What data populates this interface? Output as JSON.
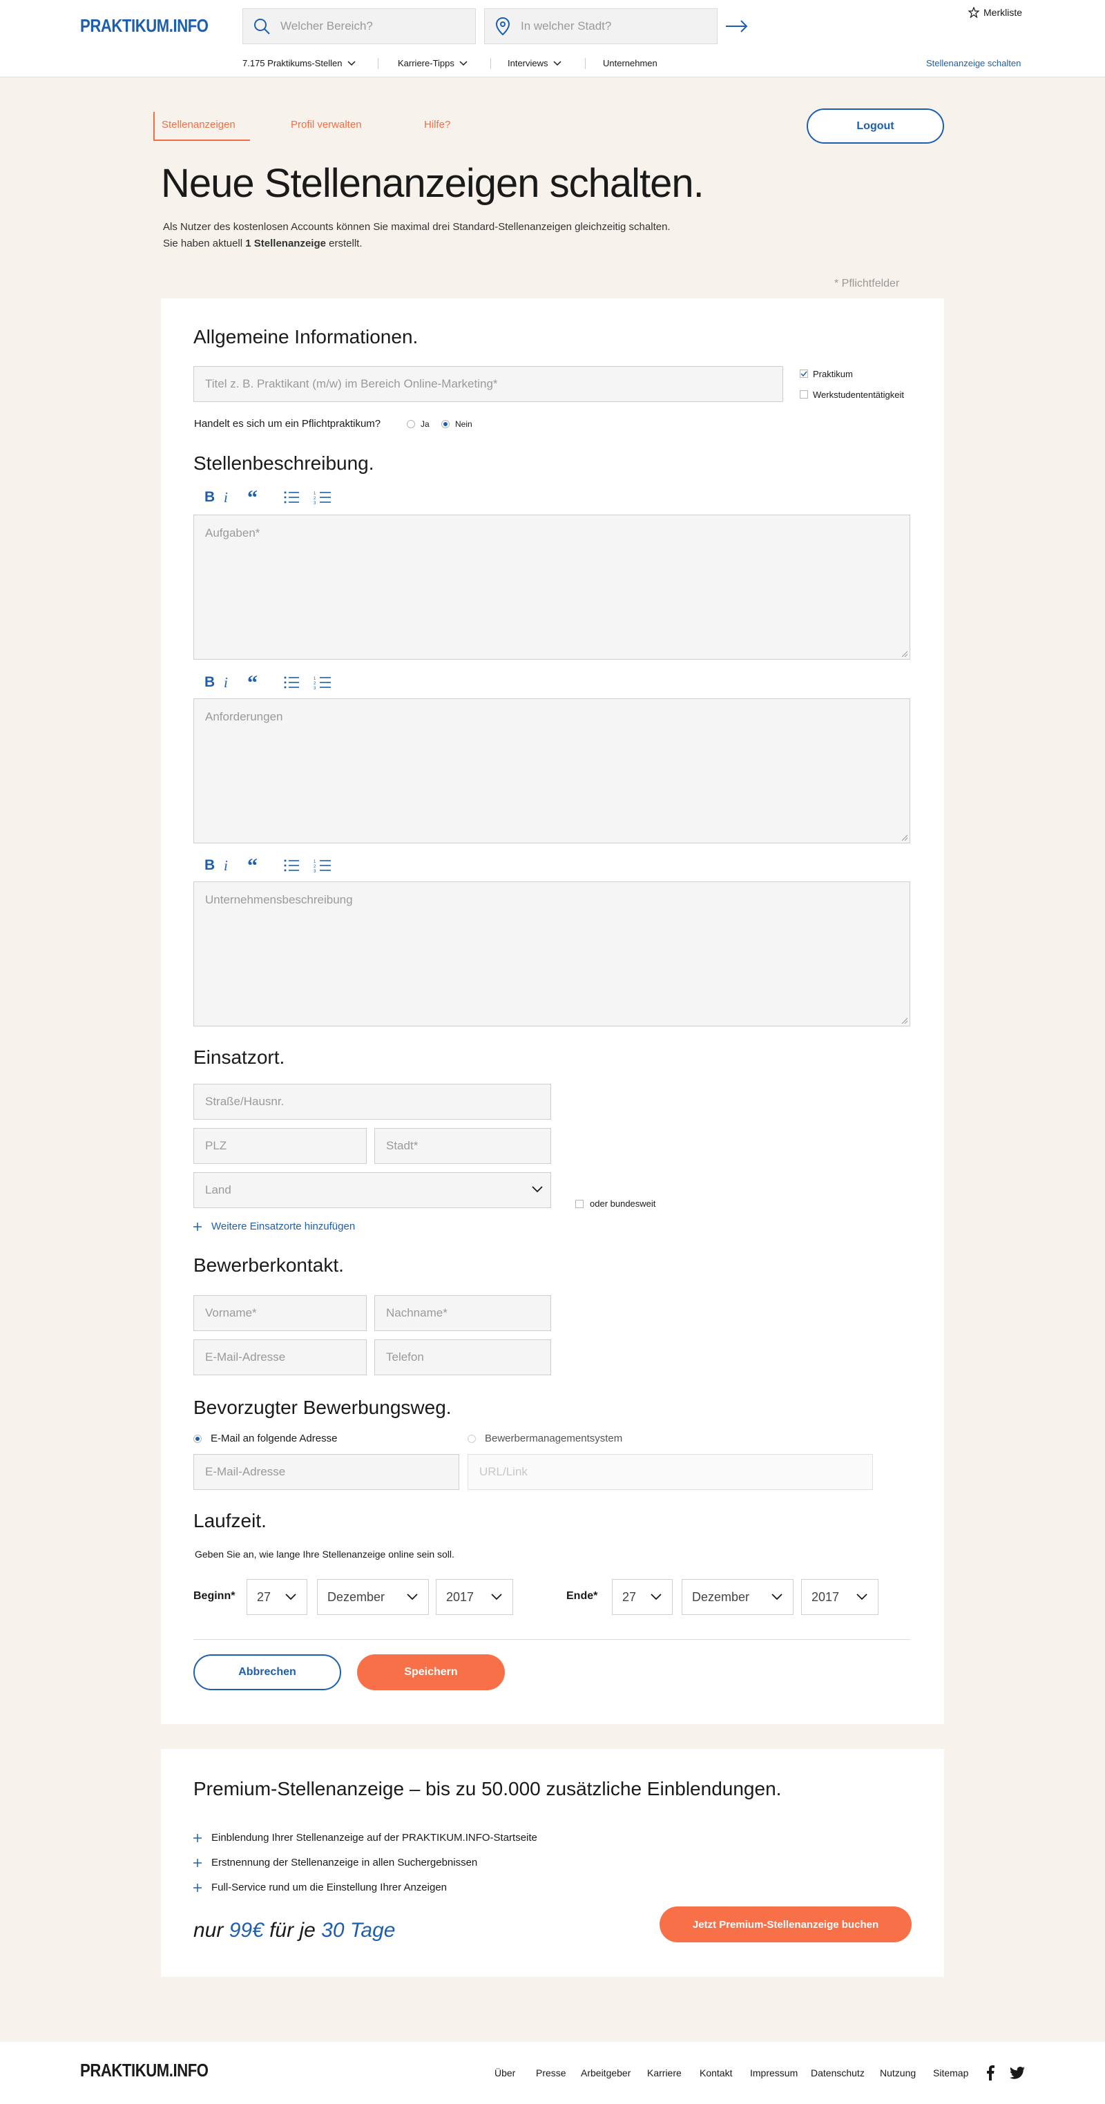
{
  "header": {
    "logo": "PRAKTIKUM.INFO",
    "search_area_placeholder": "Welcher Bereich?",
    "search_city_placeholder": "In welcher Stadt?",
    "merkliste": "Merkliste",
    "nav": [
      "7.175 Praktikums-Stellen",
      "Karriere-Tipps",
      "Interviews",
      "Unternehmen"
    ],
    "cta_link": "Stellenanzeige schalten"
  },
  "tabs": [
    "Stellenanzeigen",
    "Profil verwalten",
    "Hilfe?"
  ],
  "logout": "Logout",
  "page_title": "Neue Stellenanzeigen schalten.",
  "intro_line1": "Als Nutzer des kostenlosen Accounts können Sie maximal drei Standard-Stellenanzeigen gleichzeitig schalten.",
  "intro_line2_pre": "Sie haben aktuell ",
  "intro_line2_bold": "1 Stellenanzeige",
  "intro_line2_post": " erstellt.",
  "required_note": "* Pflichtfelder",
  "general": {
    "heading": "Allgemeine Informationen.",
    "title_placeholder": "Titel z. B. Praktikant (m/w) im Bereich Online-Marketing*",
    "type_options": [
      "Praktikum",
      "Werkstudententätigkeit"
    ],
    "mandatory_question": "Handelt es sich um ein Pflichtpraktikum?",
    "mandatory_yes": "Ja",
    "mandatory_no": "Nein"
  },
  "description": {
    "heading": "Stellenbeschreibung.",
    "tasks_placeholder": "Aufgaben*",
    "requirements_placeholder": "Anforderungen",
    "company_placeholder": "Unternehmensbeschreibung"
  },
  "location": {
    "heading": "Einsatzort.",
    "street": "Straße/Hausnr.",
    "zip": "PLZ",
    "city": "Stadt*",
    "country": "Land",
    "nationwide": "oder bundesweit",
    "add_more": "Weitere Einsatzorte hinzufügen"
  },
  "contact": {
    "heading": "Bewerberkontakt.",
    "first_name": "Vorname*",
    "last_name": "Nachname*",
    "email": "E-Mail-Adresse",
    "phone": "Telefon"
  },
  "application": {
    "heading": "Bevorzugter Bewerbungsweg.",
    "option_email": "E-Mail an folgende Adresse",
    "option_ats": "Bewerbermanagementsystem",
    "email_placeholder": "E-Mail-Adresse",
    "url_placeholder": "URL/Link"
  },
  "duration": {
    "heading": "Laufzeit.",
    "hint": "Geben Sie an, wie lange Ihre Stellenanzeige online sein soll.",
    "start_label": "Beginn*",
    "end_label": "Ende*",
    "start_day": "27",
    "start_month": "Dezember",
    "start_year": "2017",
    "end_day": "27",
    "end_month": "Dezember",
    "end_year": "2017"
  },
  "actions": {
    "cancel": "Abbrechen",
    "save": "Speichern"
  },
  "premium": {
    "heading": "Premium-Stellenanzeige – bis zu 50.000 zusätzliche Einblendungen.",
    "benefits": [
      "Einblendung Ihrer Stellenanzeige auf der PRAKTIKUM.INFO-Startseite",
      "Erstnennung der Stellenanzeige in allen Suchergebnissen",
      "Full-Service rund um die Einstellung Ihrer Anzeigen"
    ],
    "price_pre": "nur ",
    "price": "99€",
    "price_mid": " für je ",
    "days": "30 Tage",
    "cta": "Jetzt Premium-Stellenanzeige buchen"
  },
  "footer": {
    "logo": "PRAKTIKUM.INFO",
    "links": [
      "Über",
      "Presse",
      "Arbeitgeber",
      "Karriere",
      "Kontakt",
      "Impressum",
      "Datenschutz",
      "Nutzung",
      "Sitemap"
    ]
  },
  "colors": {
    "brand_blue": "#1d5fae",
    "accent_orange": "#f87048",
    "page_bg": "#f7f3ec"
  }
}
